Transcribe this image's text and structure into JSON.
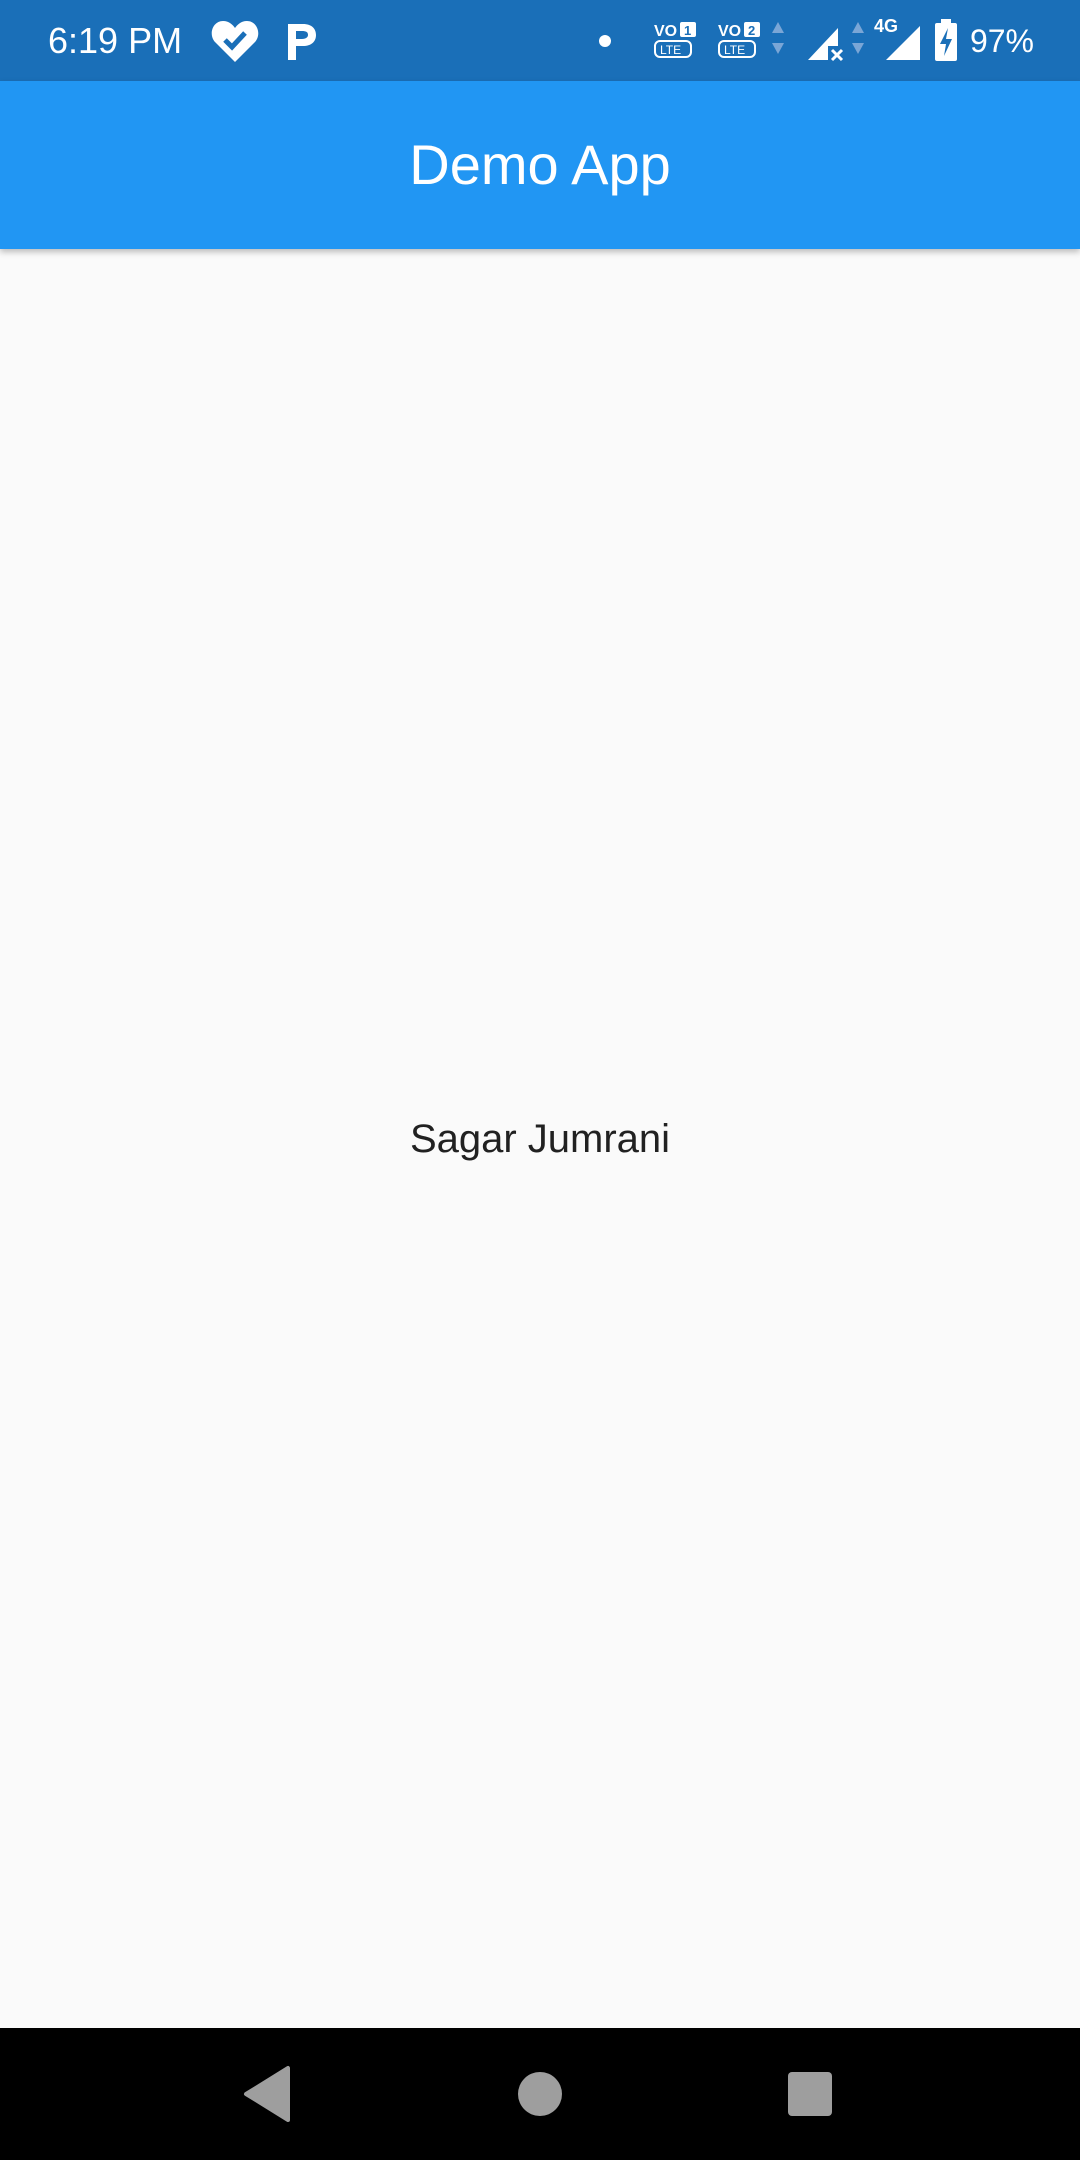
{
  "status_bar": {
    "time": "6:19 PM",
    "battery_percent": "97%",
    "network_label": "4G",
    "sim1_label": "VO1 LTE",
    "sim2_label": "VO2 LTE",
    "icons": [
      "heart-check-icon",
      "p-notification-icon",
      "dot-icon",
      "volte-sim1-icon",
      "volte-sim2-icon",
      "signal-no-service-icon",
      "signal-4g-icon",
      "battery-charging-icon"
    ]
  },
  "app_bar": {
    "title": "Demo App",
    "color": "#2196f3"
  },
  "main": {
    "text": "Sagar Jumrani"
  },
  "nav_bar": {
    "icons": [
      "back-icon",
      "home-icon",
      "recents-icon"
    ]
  }
}
